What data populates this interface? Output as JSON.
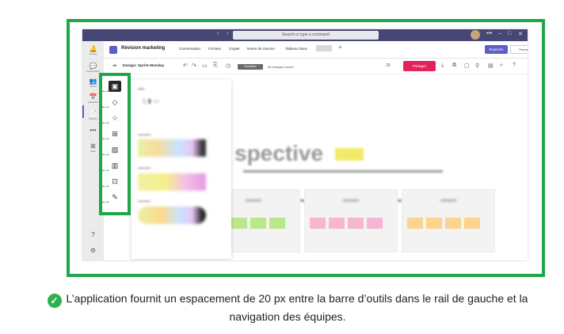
{
  "window": {
    "nav": "‹ ›",
    "search_placeholder": "Search or type a command",
    "win_controls": [
      "•••",
      "–",
      "□",
      "✕"
    ]
  },
  "rail": {
    "items": [
      {
        "icon": "bell-icon",
        "glyph": "🔔",
        "label": "Activité"
      },
      {
        "icon": "chat-icon",
        "glyph": "💬",
        "label": "Conversation"
      },
      {
        "icon": "teams-icon",
        "glyph": "👥",
        "label": "Teams"
      },
      {
        "icon": "calendar-icon",
        "glyph": "📅",
        "label": "Calendrier"
      },
      {
        "icon": "files-icon",
        "glyph": "📄",
        "label": "Fichiers"
      },
      {
        "icon": "more-icon",
        "glyph": "•••",
        "label": ""
      },
      {
        "icon": "apps-icon",
        "glyph": "⊞",
        "label": "Store"
      },
      {
        "icon": "help-icon",
        "glyph": "?",
        "label": ""
      },
      {
        "icon": "settings-icon",
        "glyph": "⚙",
        "label": ""
      }
    ]
  },
  "header": {
    "title": "Révision marketing",
    "tabs": [
      "Conversation",
      "Fichiers",
      "Onglet",
      "Notes de réunion",
      "Tableau blanc"
    ],
    "join_label": "Rejoindre",
    "close_label": "Fermer"
  },
  "whiteboard": {
    "board_name": "Design: Sprint Monday",
    "facilitator_label": "Facilitator",
    "saved_status": "All changes saved",
    "participants_count": "29",
    "share_label": "Partager",
    "heading": "spective"
  },
  "toolbar": {
    "tools": [
      {
        "name": "sticky-note-icon",
        "glyph": "▣",
        "active": true
      },
      {
        "name": "shapes-icon",
        "glyph": "◇"
      },
      {
        "name": "reactions-icon",
        "glyph": "☆"
      },
      {
        "name": "table-icon",
        "glyph": "⊞"
      },
      {
        "name": "image-icon",
        "glyph": "▨"
      },
      {
        "name": "library-icon",
        "glyph": "▥"
      },
      {
        "name": "insert-icon",
        "glyph": "⊡"
      },
      {
        "name": "pen-icon",
        "glyph": "✎"
      }
    ]
  },
  "caption": {
    "text": "L’application fournit un espacement de 20 px entre la barre d’outils dans le rail de gauche et la navigation des équipes."
  },
  "colors": {
    "accent": "#5b5fc7",
    "titlebar": "#464775",
    "highlight": "#1ea64a",
    "share": "#e0235b"
  }
}
